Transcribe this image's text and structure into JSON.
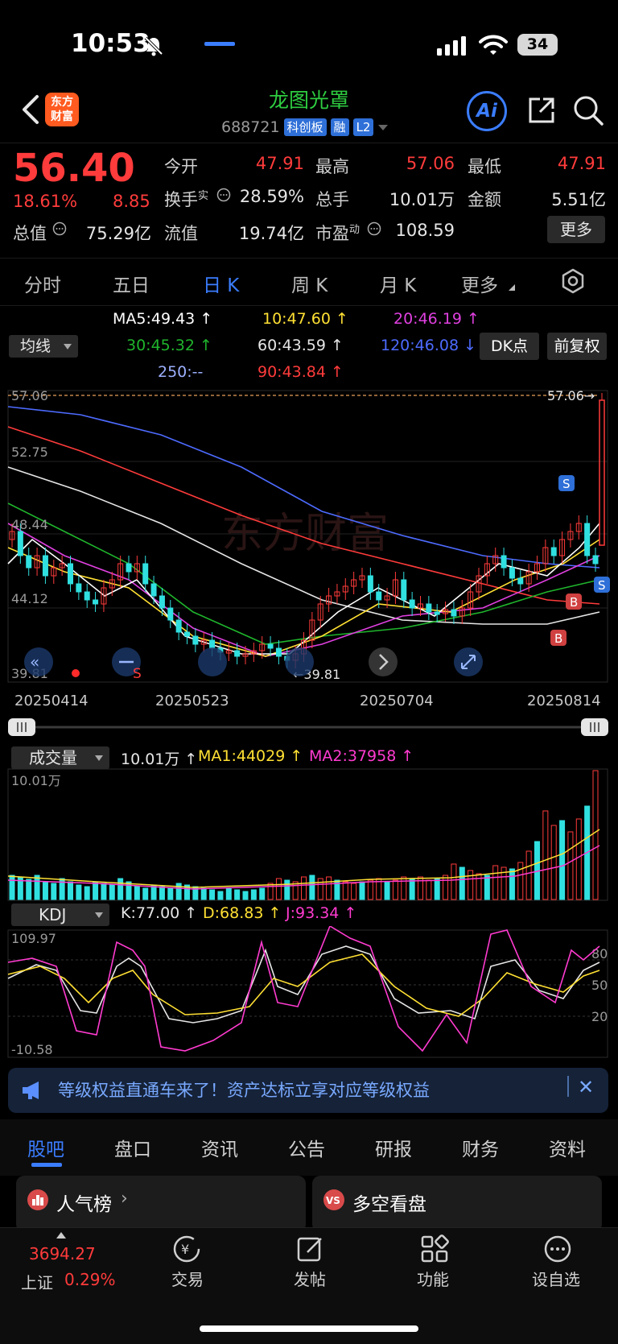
{
  "status": {
    "time": "10:53",
    "battery": "34"
  },
  "header": {
    "logo": "东方\n财富",
    "name": "龙图光罩",
    "code": "688721",
    "tags": [
      "科创板",
      "融",
      "L2"
    ],
    "ai": "Ai"
  },
  "quote": {
    "price": "56.40",
    "pct": "18.61%",
    "change": "8.85",
    "open_label": "今开",
    "open": "47.91",
    "high_label": "最高",
    "high": "57.06",
    "low_label": "最低",
    "low": "47.91",
    "turnover_label": "换手",
    "turnover_sup": "实",
    "turnover": "28.59%",
    "vol_label": "总手",
    "vol": "10.01万",
    "amount_label": "金额",
    "amount": "5.51亿",
    "mcap_label": "总值",
    "mcap": "75.29亿",
    "float_label": "流值",
    "float": "19.74亿",
    "pe_label": "市盈",
    "pe_sup": "动",
    "pe": "108.59",
    "more": "更多"
  },
  "tabs": [
    "分时",
    "五日",
    "日 K",
    "周 K",
    "月 K",
    "更多"
  ],
  "ma": {
    "select": "均线",
    "ma5": "MA5:49.43 ↑",
    "ma10": "10:47.60 ↑",
    "ma20": "20:46.19 ↑",
    "ma30": "30:45.32 ↑",
    "ma60": "60:43.59 ↑",
    "ma120": "120:46.08 ↓",
    "ma250": "250:--",
    "ma90": "90:43.84 ↑",
    "dk": "DK点",
    "fq": "前复权",
    "colors": {
      "ma5": "#ffffff",
      "ma10": "#ffe033",
      "ma20": "#e040e0",
      "ma30": "#1fb52c",
      "ma60": "#e6e6e6",
      "ma120": "#4d6bff",
      "ma250": "#9db0ff",
      "ma90": "#ff3b3b"
    }
  },
  "chart": {
    "ytop": "57.06",
    "y2": "52.75",
    "y3": "48.44",
    "y4": "44.12",
    "ybot": "39.81",
    "high_mark": "57.06→",
    "low_mark": "←39.81",
    "dates": [
      "20250414",
      "20250523",
      "20250704",
      "20250814"
    ],
    "signal_s": "S",
    "signal_b": "B",
    "watermark": "东方财富"
  },
  "chart_data": {
    "type": "candlestick",
    "title": "",
    "ylim": [
      39.81,
      57.06
    ],
    "x_ticks": [
      "20250414",
      "20250523",
      "20250704",
      "20250814"
    ],
    "last": {
      "open": 47.91,
      "high": 57.06,
      "low": 47.91,
      "close": 56.4
    },
    "series": [
      {
        "name": "MA5",
        "value": 49.43
      },
      {
        "name": "10",
        "value": 47.6
      },
      {
        "name": "20",
        "value": 46.19
      },
      {
        "name": "30",
        "value": 45.32
      },
      {
        "name": "60",
        "value": 43.59
      },
      {
        "name": "120",
        "value": 46.08
      },
      {
        "name": "90",
        "value": 43.84
      }
    ]
  },
  "volume": {
    "select": "成交量",
    "value": "10.01万 ↑",
    "ma1": "MA1:44029 ↑",
    "ma2": "MA2:37958 ↑",
    "axis": "10.01万"
  },
  "kdj": {
    "select": "KDJ",
    "k": "K:77.00 ↑",
    "d": "D:68.83 ↑",
    "j": "J:93.34 ↑",
    "top": "109.97",
    "bot": "-10.58",
    "l80": "80",
    "l50": "50",
    "l20": "20"
  },
  "banner": {
    "text": "等级权益直通车来了！资产达标立享对应等级权益"
  },
  "bottom_tabs": [
    "股吧",
    "盘口",
    "资讯",
    "公告",
    "研报",
    "财务",
    "资料"
  ],
  "cards": {
    "left": "人气榜",
    "right": "多空看盘",
    "right_icon": "VS"
  },
  "nav": {
    "index_value": "3694.27",
    "index_name": "上证",
    "index_pct": "0.29%",
    "items": [
      "交易",
      "发帖",
      "功能",
      "设自选"
    ]
  }
}
